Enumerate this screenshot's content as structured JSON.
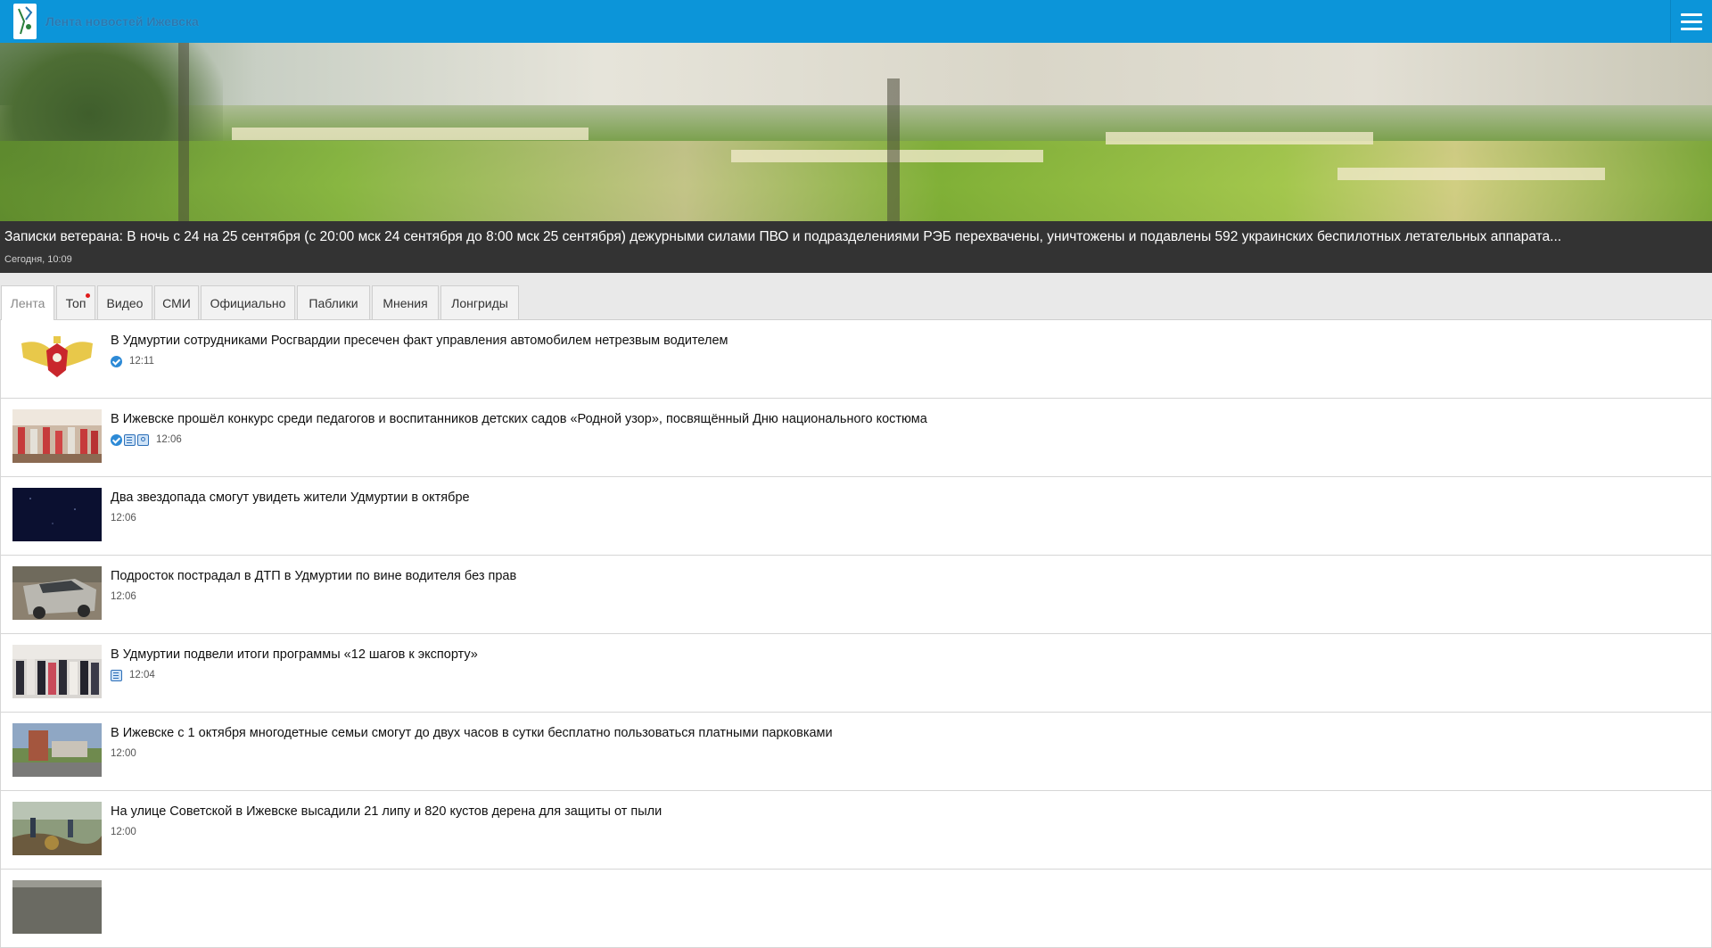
{
  "header": {
    "site_title": "Лента новостей Ижевска",
    "brand_color": "#0c95d9",
    "logo_icon": "site-logo-icon",
    "menu_icon": "hamburger-menu-icon"
  },
  "hero": {
    "title": "Записки ветерана: В ночь с 24 на 25 сентября (с 20:00 мск 24 сентября до 8:00 мск 25 сентября) дежурными силами ПВО и подразделениями РЭБ перехвачены, уничтожены и подавлены 592 украинских беспилотных летательных аппарата...",
    "date": "Сегодня, 10:09"
  },
  "tabs": [
    {
      "label": "Лента",
      "active": true
    },
    {
      "label": "Топ",
      "indicator": true
    },
    {
      "label": "Видео"
    },
    {
      "label": "СМИ"
    },
    {
      "label": "Официально"
    },
    {
      "label": "Паблики"
    },
    {
      "label": "Мнения"
    },
    {
      "label": "Лонгриды"
    }
  ],
  "news": [
    {
      "title": "В Удмуртии сотрудниками Росгвардии пресечен факт управления автомобилем нетрезвым водителем",
      "time": "12:11",
      "badges": [
        "verified-icon"
      ]
    },
    {
      "title": "В Ижевске прошёл конкурс среди педагогов и воспитанников детских садов «Родной узор», посвящённый Дню национального костюма",
      "time": "12:06",
      "badges": [
        "verified-icon",
        "article-icon",
        "photo-icon"
      ]
    },
    {
      "title": "Два звездопада смогут увидеть жители Удмуртии в октябре",
      "time": "12:06",
      "badges": []
    },
    {
      "title": "Подросток пострадал в ДТП в Удмуртии по вине водителя без прав",
      "time": "12:06",
      "badges": []
    },
    {
      "title": "В Удмуртии подвели итоги программы «12 шагов к экспорту»",
      "time": "12:04",
      "badges": [
        "article-icon"
      ]
    },
    {
      "title": "В Ижевске с 1 октября многодетные семьи смогут до двух часов в сутки бесплатно пользоваться платными парковками",
      "time": "12:00",
      "badges": []
    },
    {
      "title": "На улице Советской в Ижевске высадили 21 липу и 820 кустов дерена для защиты от пыли",
      "time": "12:00",
      "badges": []
    }
  ]
}
